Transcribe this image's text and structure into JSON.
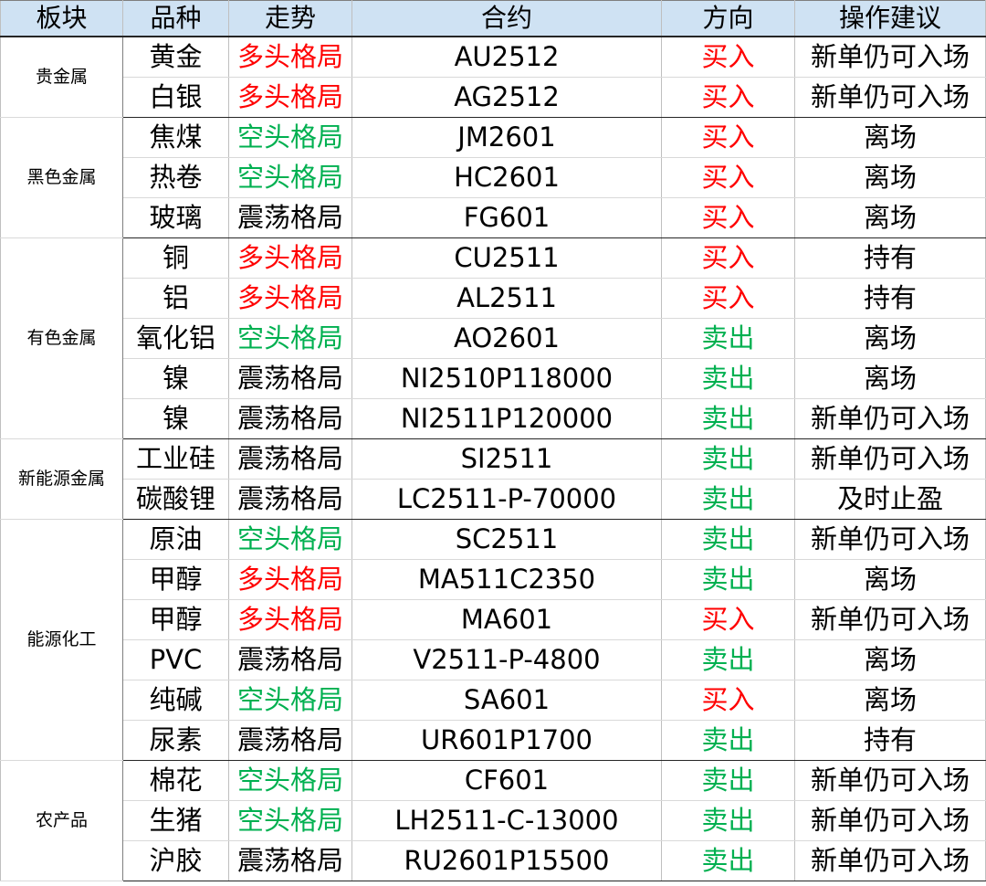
{
  "headers": {
    "sector": "板块",
    "variety": "品种",
    "trend": "走势",
    "contract": "合约",
    "direction": "方向",
    "advice": "操作建议"
  },
  "colors": {
    "header_bg": "#cfe2f3",
    "bull": "#ff0000",
    "bear": "#00b050",
    "buy": "#ff0000",
    "sell": "#00b050",
    "neutral": "#000000"
  },
  "groups": [
    {
      "sector": "贵金属",
      "rows": [
        {
          "variety": "黄金",
          "trend": "多头格局",
          "contract": "AU2512",
          "direction": "买入",
          "advice": "新单仍可入场"
        },
        {
          "variety": "白银",
          "trend": "多头格局",
          "contract": "AG2512",
          "direction": "买入",
          "advice": "新单仍可入场"
        }
      ]
    },
    {
      "sector": "黑色金属",
      "rows": [
        {
          "variety": "焦煤",
          "trend": "空头格局",
          "contract": "JM2601",
          "direction": "买入",
          "advice": "离场"
        },
        {
          "variety": "热卷",
          "trend": "空头格局",
          "contract": "HC2601",
          "direction": "买入",
          "advice": "离场"
        },
        {
          "variety": "玻璃",
          "trend": "震荡格局",
          "contract": "FG601",
          "direction": "买入",
          "advice": "离场"
        }
      ]
    },
    {
      "sector": "有色金属",
      "rows": [
        {
          "variety": "铜",
          "trend": "多头格局",
          "contract": "CU2511",
          "direction": "买入",
          "advice": "持有"
        },
        {
          "variety": "铝",
          "trend": "多头格局",
          "contract": "AL2511",
          "direction": "买入",
          "advice": "持有"
        },
        {
          "variety": "氧化铝",
          "trend": "空头格局",
          "contract": "AO2601",
          "direction": "卖出",
          "advice": "离场"
        },
        {
          "variety": "镍",
          "trend": "震荡格局",
          "contract": "NI2510P118000",
          "direction": "卖出",
          "advice": "离场"
        },
        {
          "variety": "镍",
          "trend": "震荡格局",
          "contract": "NI2511P120000",
          "direction": "卖出",
          "advice": "新单仍可入场"
        }
      ]
    },
    {
      "sector": "新能源金属",
      "rows": [
        {
          "variety": "工业硅",
          "trend": "震荡格局",
          "contract": "SI2511",
          "direction": "卖出",
          "advice": "新单仍可入场"
        },
        {
          "variety": "碳酸锂",
          "trend": "震荡格局",
          "contract": "LC2511-P-70000",
          "direction": "卖出",
          "advice": "及时止盈"
        }
      ]
    },
    {
      "sector": "能源化工",
      "rows": [
        {
          "variety": "原油",
          "trend": "空头格局",
          "contract": "SC2511",
          "direction": "卖出",
          "advice": "新单仍可入场"
        },
        {
          "variety": "甲醇",
          "trend": "多头格局",
          "contract": "MA511C2350",
          "direction": "卖出",
          "advice": "离场"
        },
        {
          "variety": "甲醇",
          "trend": "多头格局",
          "contract": "MA601",
          "direction": "买入",
          "advice": "新单仍可入场"
        },
        {
          "variety": "PVC",
          "trend": "震荡格局",
          "contract": "V2511-P-4800",
          "direction": "卖出",
          "advice": "离场"
        },
        {
          "variety": "纯碱",
          "trend": "空头格局",
          "contract": "SA601",
          "direction": "买入",
          "advice": "离场"
        },
        {
          "variety": "尿素",
          "trend": "震荡格局",
          "contract": "UR601P1700",
          "direction": "卖出",
          "advice": "持有"
        }
      ]
    },
    {
      "sector": "农产品",
      "rows": [
        {
          "variety": "棉花",
          "trend": "空头格局",
          "contract": "CF601",
          "direction": "卖出",
          "advice": "新单仍可入场"
        },
        {
          "variety": "生猪",
          "trend": "空头格局",
          "contract": "LH2511-C-13000",
          "direction": "卖出",
          "advice": "新单仍可入场"
        },
        {
          "variety": "沪胶",
          "trend": "震荡格局",
          "contract": "RU2601P15500",
          "direction": "卖出",
          "advice": "新单仍可入场"
        }
      ]
    }
  ]
}
